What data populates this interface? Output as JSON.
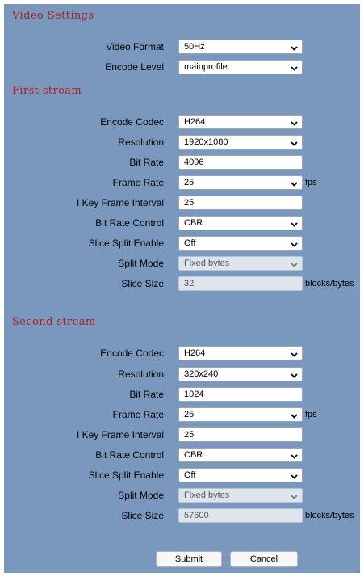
{
  "video_settings": {
    "title": "Video Settings",
    "video_format": {
      "label": "Video Format",
      "value": "50Hz"
    },
    "encode_level": {
      "label": "Encode Level",
      "value": "mainprofile"
    }
  },
  "first_stream": {
    "title": "First stream",
    "encode_codec": {
      "label": "Encode Codec",
      "value": "H264"
    },
    "resolution": {
      "label": "Resolution",
      "value": "1920x1080"
    },
    "bit_rate": {
      "label": "Bit Rate",
      "value": "4096"
    },
    "frame_rate": {
      "label": "Frame Rate",
      "value": "25",
      "unit": "fps"
    },
    "i_key_frame_interval": {
      "label": "I Key Frame Interval",
      "value": "25"
    },
    "bit_rate_control": {
      "label": "Bit Rate Control",
      "value": "CBR"
    },
    "slice_split_enable": {
      "label": "Slice Split Enable",
      "value": "Off"
    },
    "split_mode": {
      "label": "Split Mode",
      "value": "Fixed bytes"
    },
    "slice_size": {
      "label": "Slice Size",
      "value": "32",
      "unit": "blocks/bytes"
    }
  },
  "second_stream": {
    "title": "Second stream",
    "encode_codec": {
      "label": "Encode Codec",
      "value": "H264"
    },
    "resolution": {
      "label": "Resolution",
      "value": "320x240"
    },
    "bit_rate": {
      "label": "Bit Rate",
      "value": "1024"
    },
    "frame_rate": {
      "label": "Frame Rate",
      "value": "25",
      "unit": "fps"
    },
    "i_key_frame_interval": {
      "label": "I Key Frame Interval",
      "value": "25"
    },
    "bit_rate_control": {
      "label": "Bit Rate Control",
      "value": "CBR"
    },
    "slice_split_enable": {
      "label": "Slice Split Enable",
      "value": "Off"
    },
    "split_mode": {
      "label": "Split Mode",
      "value": "Fixed bytes"
    },
    "slice_size": {
      "label": "Slice Size",
      "value": "57600",
      "unit": "blocks/bytes"
    }
  },
  "buttons": {
    "submit": "Submit",
    "cancel": "Cancel"
  },
  "colors": {
    "panel": "#7a98bd",
    "section_title": "#ad1e1e",
    "disabled_field": "#dfe5ec"
  },
  "icons": {
    "select_arrow": "chevron-down-icon"
  }
}
